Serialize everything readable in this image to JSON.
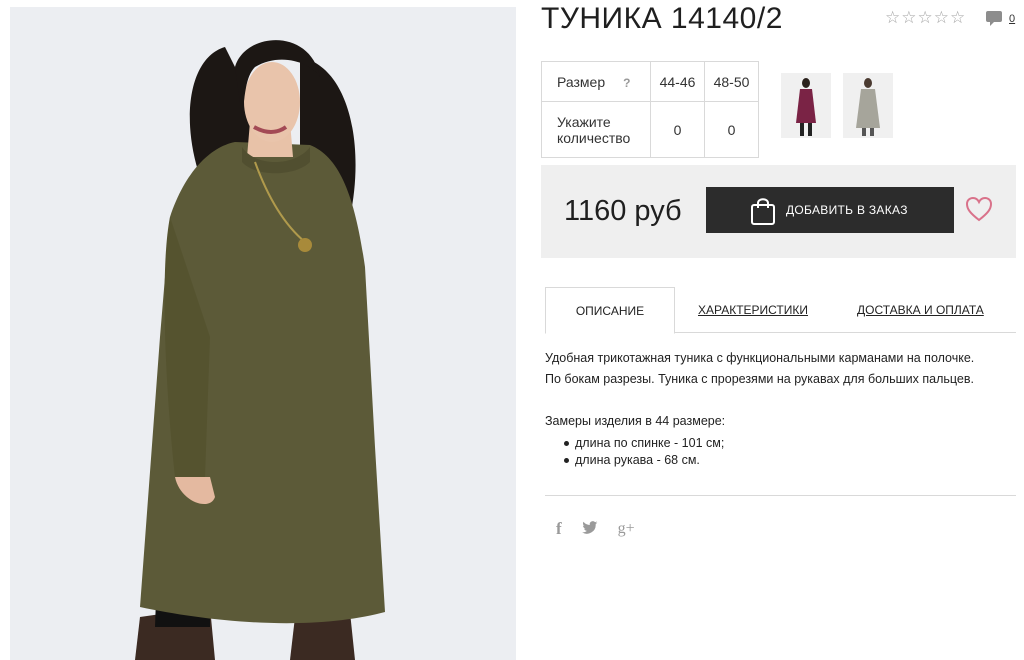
{
  "product": {
    "title": "ТУНИКА 14140/2",
    "rating_stars": "☆☆☆☆☆",
    "comments_count": "0"
  },
  "size_table": {
    "size_label": "Размер",
    "help_mark": "?",
    "sizes": [
      "44-46",
      "48-50"
    ],
    "qty_label": "Укажите количество",
    "quantities": [
      "0",
      "0"
    ]
  },
  "thumbnails": [
    {
      "name": "thumbnail-burgundy",
      "color": "#7a2345"
    },
    {
      "name": "thumbnail-grey",
      "color": "#a6a59b"
    }
  ],
  "buy": {
    "price": "1160 руб",
    "add_button_label": "ДОБАВИТЬ В ЗАКАЗ"
  },
  "tabs": [
    {
      "label": "ОПИСАНИЕ",
      "active": true
    },
    {
      "label": "ХАРАКТЕРИСТИКИ",
      "active": false
    },
    {
      "label": "ДОСТАВКА И ОПЛАТА",
      "active": false
    }
  ],
  "description": {
    "line1": "Удобная трикотажная туника с функциональными карманами на полочке.",
    "line2": "По бокам разрезы. Туника с прорезями на рукавах для больших пальцев.",
    "measures_title": "Замеры изделия в 44 размере:",
    "measures": [
      "длина по спинке - 101 см;",
      "длина рукава - 68 см."
    ]
  },
  "share": {
    "facebook": "f",
    "twitter": "twitter-bird",
    "google_plus": "g+"
  },
  "colors": {
    "tunic": "#5c5a38",
    "button": "#2c2c2c",
    "heart": "#d9728a",
    "buybox_bg": "#efefef"
  }
}
